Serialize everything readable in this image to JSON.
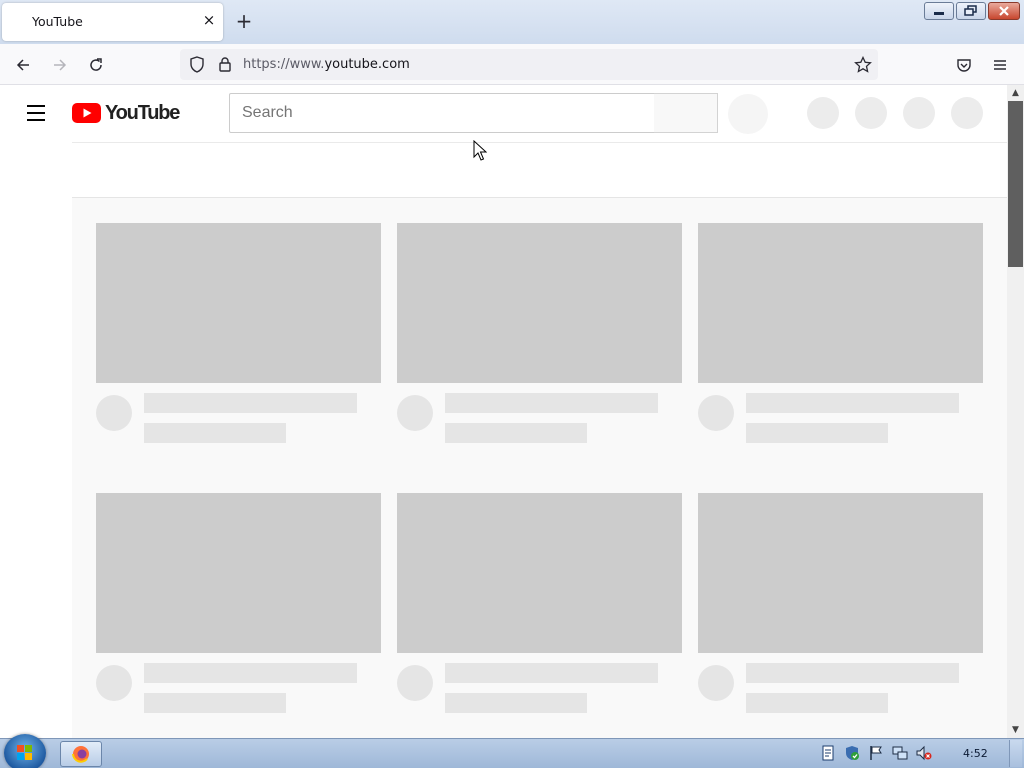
{
  "browser": {
    "tab_title": "YouTube",
    "tab_close_glyph": "×",
    "new_tab_glyph": "+",
    "url_prefix": "https://www.",
    "url_domain": "youtube.com",
    "window_buttons": [
      "minimize",
      "restore",
      "close"
    ]
  },
  "youtube": {
    "logo_text": "YouTube",
    "search_placeholder": "Search",
    "search_value": "",
    "brand_red": "#ff0000"
  },
  "feed": {
    "state": "loading-skeleton",
    "cards": [
      {
        "row": 1,
        "col": 1
      },
      {
        "row": 1,
        "col": 2
      },
      {
        "row": 1,
        "col": 3
      },
      {
        "row": 2,
        "col": 1
      },
      {
        "row": 2,
        "col": 2
      },
      {
        "row": 2,
        "col": 3
      }
    ]
  },
  "taskbar": {
    "clock": "4:52",
    "pinned": [
      "firefox-icon"
    ],
    "tray_icons": [
      "document-icon",
      "shield-check-icon",
      "flag-icon",
      "network-icon",
      "volume-muted-icon"
    ]
  },
  "colors": {
    "skeleton_thumb": "#cccccc",
    "skeleton_text": "#e5e5e5",
    "feed_background": "#f9f9f9"
  }
}
